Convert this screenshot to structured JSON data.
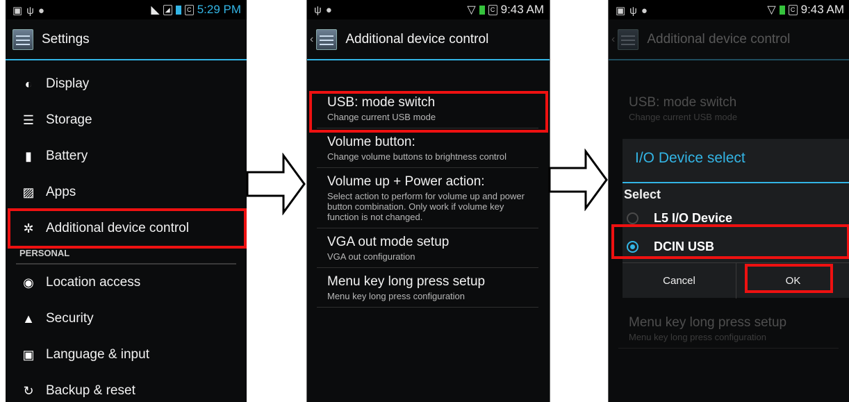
{
  "colors": {
    "accent": "#33b5e5",
    "highlight": "#ee1111",
    "background": "#0b0c0d"
  },
  "screen1": {
    "time": "5:29 PM",
    "title": "Settings",
    "items": [
      {
        "label": "Display",
        "icon": "display-icon"
      },
      {
        "label": "Storage",
        "icon": "storage-icon"
      },
      {
        "label": "Battery",
        "icon": "battery-icon"
      },
      {
        "label": "Apps",
        "icon": "apps-icon"
      },
      {
        "label": "Additional device control",
        "icon": "gear-icon"
      }
    ],
    "personal_header": "PERSONAL",
    "personal_items": [
      {
        "label": "Location access",
        "icon": "location-icon"
      },
      {
        "label": "Security",
        "icon": "lock-icon"
      },
      {
        "label": "Language & input",
        "icon": "language-icon"
      },
      {
        "label": "Backup & reset",
        "icon": "backup-icon"
      }
    ]
  },
  "screen2": {
    "time": "9:43 AM",
    "title": "Additional device control",
    "items": [
      {
        "title": "USB: mode switch",
        "subtitle": "Change current USB mode"
      },
      {
        "title": "Volume button:",
        "subtitle": "Change volume buttons to brightness control"
      },
      {
        "title": "Volume up + Power action:",
        "subtitle": "Select action to perform for volume up and power button combination. Only work if volume key function is not changed."
      },
      {
        "title": "VGA out mode setup",
        "subtitle": "VGA out configuration"
      },
      {
        "title": "Menu key long press setup",
        "subtitle": "Menu key long press configuration"
      }
    ]
  },
  "screen3": {
    "time": "9:43 AM",
    "title": "Additional device control",
    "bg_item1": {
      "title": "USB: mode switch",
      "subtitle": "Change current USB mode"
    },
    "bg_item2": {
      "title": "Menu key long press setup",
      "subtitle": "Menu key long press configuration"
    },
    "dialog": {
      "title": "I/O Device select",
      "select_label": "Select",
      "options": [
        {
          "label": "L5 I/O Device",
          "selected": false
        },
        {
          "label": "DCIN USB",
          "selected": true
        }
      ],
      "cancel": "Cancel",
      "ok": "OK"
    }
  }
}
